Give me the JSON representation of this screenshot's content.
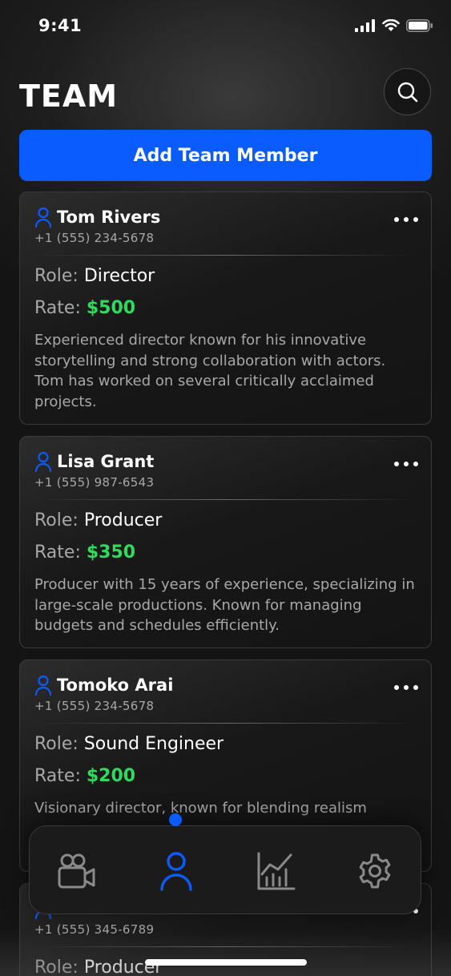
{
  "status_bar": {
    "time": "9:41"
  },
  "header": {
    "title": "TEAM"
  },
  "actions": {
    "add_label": "Add Team Member"
  },
  "labels": {
    "role": "Role:",
    "rate": "Rate:"
  },
  "members": [
    {
      "name": "Tom Rivers",
      "phone": "+1 (555) 234-5678",
      "role": "Director",
      "rate": "$500",
      "description": "Experienced director known for his innovative storytelling and strong collaboration with actors. Tom has worked on several critically acclaimed projects."
    },
    {
      "name": "Lisa Grant",
      "phone": "+1 (555) 987-6543",
      "role": "Producer",
      "rate": "$350",
      "description": "Producer with 15 years of experience, specializing in large-scale productions. Known for managing budgets and schedules efficiently."
    },
    {
      "name": "Tomoko Arai",
      "phone": "+1 (555) 234-5678",
      "role": "Sound Engineer",
      "rate": "$200",
      "description": "Visionary director, known for blending realism"
    },
    {
      "name": "",
      "phone": "+1 (555) 345-6789",
      "role": "Producer",
      "rate": "",
      "description": ""
    }
  ],
  "tab_bar": {
    "items": [
      {
        "icon": "video-camera-icon",
        "active": false
      },
      {
        "icon": "person-icon",
        "active": true
      },
      {
        "icon": "chart-icon",
        "active": false
      },
      {
        "icon": "gear-icon",
        "active": false
      }
    ]
  },
  "colors": {
    "accent": "#0a5cff",
    "rate": "#2edc5c",
    "muted_text": "#a8a8a8",
    "inactive_icon": "#8a8a8a"
  }
}
